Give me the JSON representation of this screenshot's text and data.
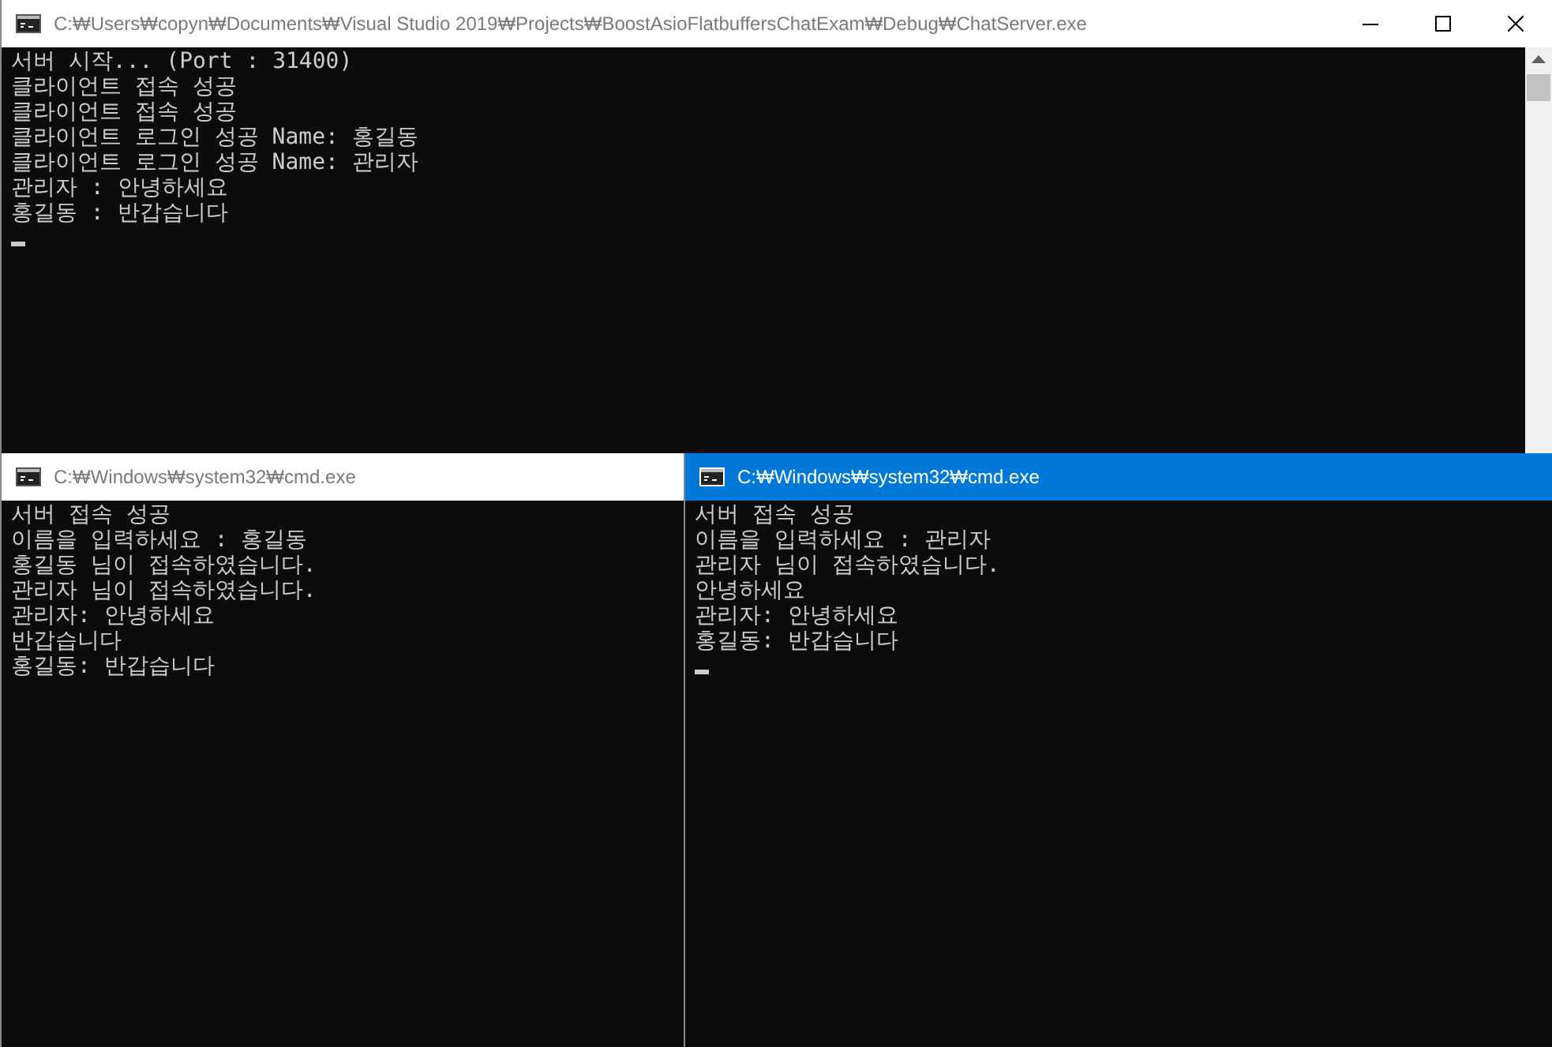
{
  "windows": [
    {
      "title": "C:₩Users₩copyn₩Documents₩Visual Studio 2019₩Projects₩BoostAsioFlatbuffersChatExam₩Debug₩ChatServer.exe",
      "active": false,
      "title_buttons": true,
      "scrollbar": true,
      "cursor": true,
      "lines": [
        "서버 시작... (Port : 31400)",
        "클라이언트 접속 성공",
        "클라이언트 접속 성공",
        "클라이언트 로그인 성공 Name: 홍길동",
        "클라이언트 로그인 성공 Name: 관리자",
        "관리자 : 안녕하세요",
        "홍길동 : 반갑습니다"
      ]
    },
    {
      "title": "C:₩Windows₩system32₩cmd.exe",
      "active": false,
      "title_buttons": false,
      "scrollbar": false,
      "cursor": false,
      "lines": [
        "서버 접속 성공",
        "이름을 입력하세요 : 홍길동",
        "홍길동 님이 접속하였습니다.",
        "관리자 님이 접속하였습니다.",
        "관리자: 안녕하세요",
        "반갑습니다",
        "홍길동: 반갑습니다"
      ]
    },
    {
      "title": "C:₩Windows₩system32₩cmd.exe",
      "active": true,
      "title_buttons": false,
      "scrollbar": false,
      "cursor": true,
      "lines": [
        "서버 접속 성공",
        "이름을 입력하세요 : 관리자",
        "관리자 님이 접속하였습니다.",
        "안녕하세요",
        "관리자: 안녕하세요",
        "홍길동: 반갑습니다"
      ]
    }
  ]
}
